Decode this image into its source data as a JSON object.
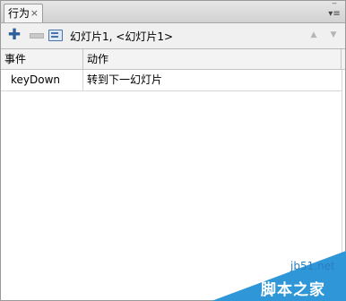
{
  "tab": {
    "label": "行为",
    "close_glyph": "×"
  },
  "panel_menu_glyph": "▾≡",
  "toolbar": {
    "add_glyph": "✚",
    "target_label": "幻灯片1, <幻灯片1>",
    "up_glyph": "▲",
    "down_glyph": "▼"
  },
  "table": {
    "headers": [
      "事件",
      "动作"
    ],
    "rows": [
      {
        "event": "keyDown",
        "action": "转到下一幻灯片"
      }
    ]
  },
  "watermark": {
    "url": "jb51.net",
    "name": "脚本之家",
    "color": "#2f97d8"
  }
}
